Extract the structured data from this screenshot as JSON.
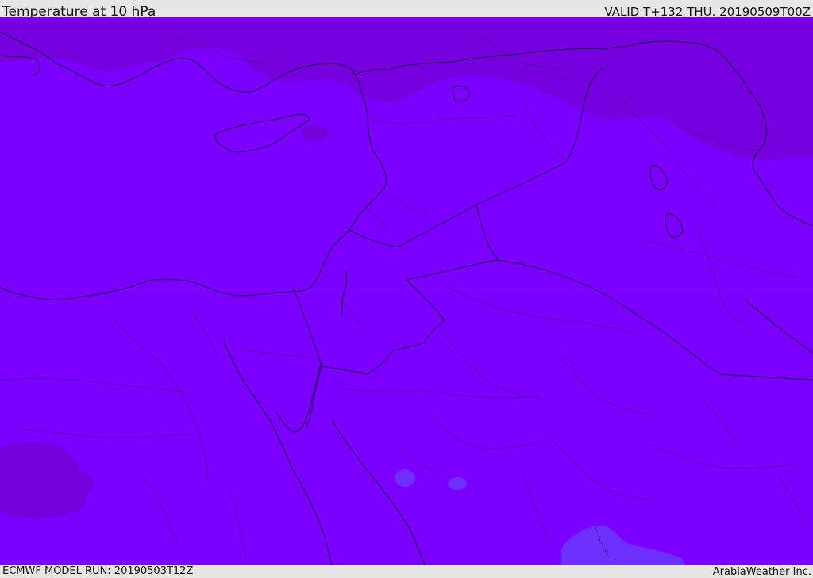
{
  "header": {
    "title": "Temperature at 10 hPa",
    "valid": "VALID T+132 THU. 20190509T00Z"
  },
  "footer": {
    "model_run": "ECMWF MODEL RUN: 20190503T12Z",
    "credit": "ArabiaWeather Inc."
  },
  "map": {
    "variable": "Temperature",
    "level": "10 hPa",
    "colors": {
      "main_fill": "#7b00ff",
      "darker_zone": "#7600dd",
      "lighter_zone": "#6a2cff",
      "borders": "#1a0040"
    }
  }
}
